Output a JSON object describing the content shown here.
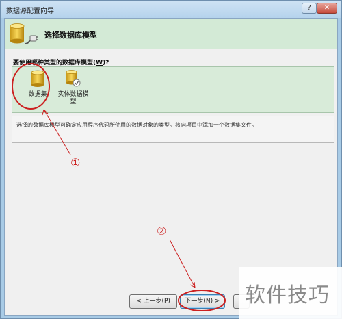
{
  "window": {
    "title": "数据源配置向导",
    "help_label": "?",
    "close_label": "✕"
  },
  "header": {
    "title": "选择数据库模型",
    "icon": "database-plug-icon"
  },
  "prompt": {
    "text": "要使用哪种类型的数据库模型(",
    "access_key": "W",
    "suffix": ")?"
  },
  "models": [
    {
      "label": "数据集",
      "icon": "dataset-icon",
      "selected": true
    },
    {
      "label": "实体数据模\n型",
      "icon": "entity-data-model-icon",
      "selected": false
    }
  ],
  "description": "选择的数据库模型可确定应用程序代码所使用的数据对象的类型。将向项目中添加一个数据集文件。",
  "buttons": {
    "back": "< 上一步(P)",
    "next": "下一步(N) >",
    "finish": ""
  },
  "annotations": {
    "marker_1": "①",
    "marker_2": "②"
  },
  "watermark": "软件技巧",
  "colors": {
    "header_bg": "#d3ead6",
    "list_bg": "#d8ebd9",
    "annotation": "#cc2020"
  }
}
